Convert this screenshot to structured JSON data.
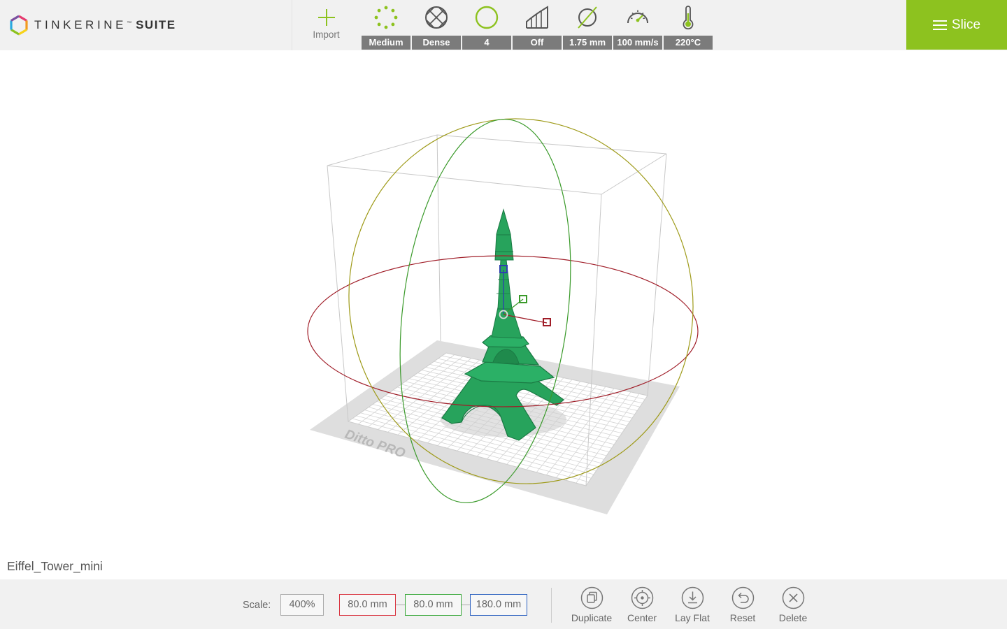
{
  "brand": {
    "name": "TINKERINE",
    "tm": "™",
    "suite": "SUITE"
  },
  "toolbar": {
    "import_label": "Import",
    "settings": [
      {
        "id": "quality",
        "icon": "quality-dots-icon",
        "value": "Medium"
      },
      {
        "id": "infill",
        "icon": "infill-density-icon",
        "value": "Dense"
      },
      {
        "id": "shells",
        "icon": "shell-circle-icon",
        "value": "4"
      },
      {
        "id": "support",
        "icon": "support-structure-icon",
        "value": "Off"
      },
      {
        "id": "filament",
        "icon": "filament-diameter-icon",
        "value": "1.75 mm"
      },
      {
        "id": "speed",
        "icon": "speedometer-icon",
        "value": "100 mm/s"
      },
      {
        "id": "temperature",
        "icon": "thermometer-icon",
        "value": "220°C"
      }
    ],
    "slice_label": "Slice"
  },
  "viewport": {
    "model_name": "Eiffel_Tower_mini",
    "printer_label": "Ditto PRO"
  },
  "bottom": {
    "scale_label": "Scale:",
    "scale_value": "400%",
    "x_value": "80.0 mm",
    "y_value": "80.0 mm",
    "z_value": "180.0 mm",
    "tools": [
      {
        "id": "duplicate",
        "icon": "duplicate-icon",
        "label": "Duplicate"
      },
      {
        "id": "center",
        "icon": "crosshair-center-icon",
        "label": "Center"
      },
      {
        "id": "layflat",
        "icon": "lay-flat-arrow-icon",
        "label": "Lay Flat"
      },
      {
        "id": "reset",
        "icon": "reset-undo-icon",
        "label": "Reset"
      },
      {
        "id": "delete",
        "icon": "delete-x-icon",
        "label": "Delete"
      }
    ]
  },
  "colors": {
    "accent": "#8dc21f",
    "model": "#27a35c",
    "toolbar_bg": "#f1f1f1",
    "value_tag": "#7b7b7b",
    "x_axis": "#d9333f",
    "y_axis": "#39a83a",
    "z_axis": "#2d62c0"
  }
}
